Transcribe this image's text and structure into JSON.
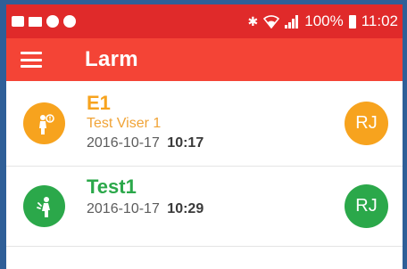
{
  "status_bar": {
    "left_icons": [
      "image-icon",
      "mail-icon",
      "notification-icon",
      "messenger-icon"
    ],
    "bluetooth": "✱",
    "battery_percent": "100%",
    "time": "11:02"
  },
  "app_bar": {
    "menu_icon": "hamburger-menu-icon",
    "title": "Larm"
  },
  "alarms": [
    {
      "title": "E1",
      "subtitle": "Test Viser 1",
      "date": "2016-10-17",
      "time": "10:17",
      "initials": "RJ",
      "color": "#f7a31e",
      "icon": "person-alert-icon"
    },
    {
      "title": "Test1",
      "date": "2016-10-17",
      "time": "10:29",
      "initials": "RJ",
      "color": "#2ba84a",
      "icon": "person-fall-icon"
    }
  ],
  "colors": {
    "status_bar": "#e02a2a",
    "app_bar": "#f44436",
    "frame": "#2f5f98"
  }
}
